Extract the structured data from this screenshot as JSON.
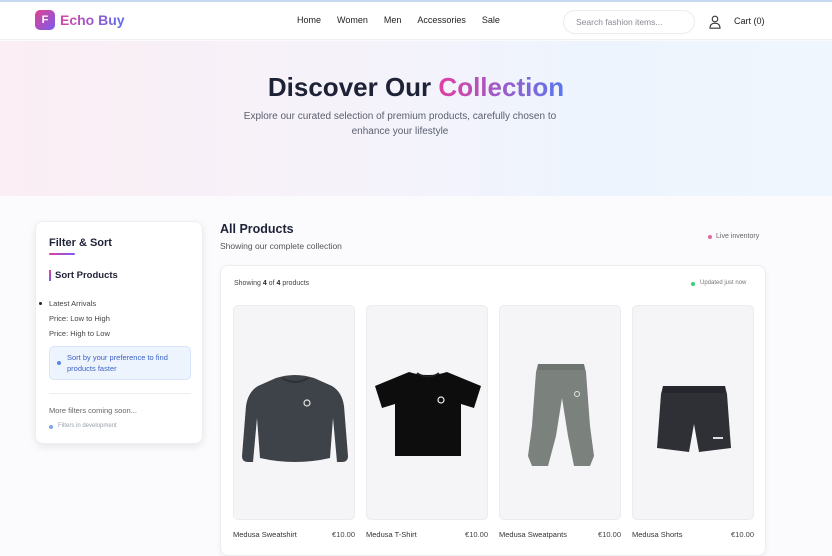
{
  "brand": {
    "logo_letter": "F",
    "name": "Echo Buy"
  },
  "nav": {
    "items": [
      "Home",
      "Women",
      "Men",
      "Accessories",
      "Sale"
    ]
  },
  "search": {
    "placeholder": "Search fashion items..."
  },
  "header_icons": {
    "user": "user-icon"
  },
  "cart": {
    "label": "Cart (0)"
  },
  "hero": {
    "title_main": "Discover Our",
    "title_accent": "Collection",
    "subtitle": "Explore our curated selection of premium products, carefully chosen to enhance your lifestyle"
  },
  "sidebar": {
    "title": "Filter & Sort",
    "sort_title": "Sort Products",
    "sort_options": [
      "Latest Arrivals",
      "Price: Low to High",
      "Price: High to Low"
    ],
    "selected_option": "Latest Arrivals",
    "tip": "Sort by your preference to find products faster",
    "more_filters": "More filters coming soon...",
    "dev_note": "Filters in development"
  },
  "main": {
    "title": "All Products",
    "subtitle": "Showing our complete collection",
    "live_label": "Live inventory",
    "showing_prefix": "Showing",
    "showing_count": "4",
    "showing_of": "of",
    "showing_total": "4",
    "showing_suffix": "products",
    "updated_label": "Updated just now"
  },
  "products": [
    {
      "name": "Medusa Sweatshirt",
      "price": "€10.00"
    },
    {
      "name": "Medusa T-Shirt",
      "price": "€10.00"
    },
    {
      "name": "Medusa Sweatpants",
      "price": "€10.00"
    },
    {
      "name": "Medusa Shorts",
      "price": "€10.00"
    }
  ],
  "colors": {
    "brand_pink": "#e13fa3",
    "brand_blue": "#5a78ec",
    "live_dot": "#e06aa6",
    "updated_dot": "#3bcf7c"
  }
}
